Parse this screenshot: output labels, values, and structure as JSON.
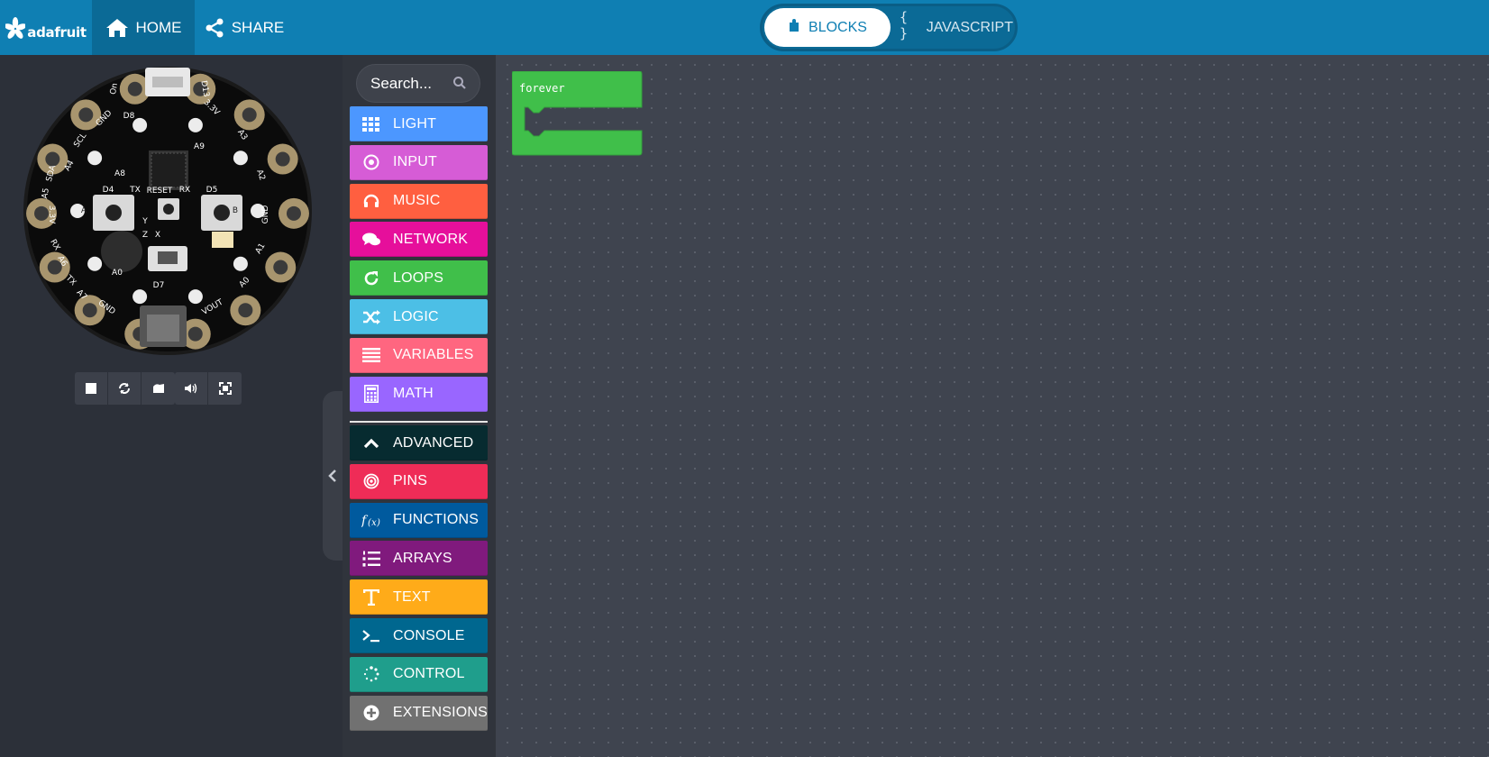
{
  "brand": {
    "name": "adafruit"
  },
  "nav": {
    "home_label": "HOME",
    "share_label": "SHARE"
  },
  "editor_toggle": {
    "blocks_label": "BLOCKS",
    "javascript_label": "JAVASCRIPT",
    "active": "BLOCKS"
  },
  "simulator": {
    "board_labels": [
      "On",
      "D13",
      "D8",
      "GND",
      "SCL",
      "A4",
      "3.3V",
      "A3",
      "A9",
      "A8",
      "SDA",
      "A5",
      "A2",
      "D4",
      "TX",
      "RESET",
      "RX",
      "D5",
      "3.3V",
      "GND",
      "RX",
      "A6",
      "A1",
      "Y",
      "Z",
      "X",
      "A0",
      "D7",
      "TX",
      "A7",
      "A0",
      "GND",
      "VOUT",
      "A",
      "B"
    ],
    "controls": [
      "stop-icon",
      "restart-icon",
      "slow-motion-icon",
      "sound-icon",
      "fullscreen-icon"
    ]
  },
  "toolbox": {
    "search_placeholder": "Search...",
    "categories": [
      {
        "label": "LIGHT",
        "color": "#4c97ff",
        "icon": "grid-icon"
      },
      {
        "label": "INPUT",
        "color": "#d65cd6",
        "icon": "target-icon"
      },
      {
        "label": "MUSIC",
        "color": "#ff5f40",
        "icon": "headphones-icon"
      },
      {
        "label": "NETWORK",
        "color": "#e60f9b",
        "icon": "chat-icon"
      },
      {
        "label": "LOOPS",
        "color": "#40bf4a",
        "icon": "refresh-icon"
      },
      {
        "label": "LOGIC",
        "color": "#4cbfe6",
        "icon": "shuffle-icon"
      },
      {
        "label": "VARIABLES",
        "color": "#ff6680",
        "icon": "list-lines-icon"
      },
      {
        "label": "MATH",
        "color": "#9966ff",
        "icon": "calculator-icon"
      }
    ],
    "advanced": [
      {
        "label": "ADVANCED",
        "color": "#072b30",
        "icon": "chevron-up-icon"
      },
      {
        "label": "PINS",
        "color": "#ef2c57",
        "icon": "pin-circle-icon"
      },
      {
        "label": "FUNCTIONS",
        "color": "#005a9e",
        "icon": "function-icon"
      },
      {
        "label": "ARRAYS",
        "color": "#801a7d",
        "icon": "numbered-list-icon"
      },
      {
        "label": "TEXT",
        "color": "#ffab19",
        "icon": "text-icon"
      },
      {
        "label": "CONSOLE",
        "color": "#00678f",
        "icon": "terminal-icon"
      },
      {
        "label": "CONTROL",
        "color": "#1f9e8c",
        "icon": "dotted-circle-icon"
      },
      {
        "label": "EXTENSIONS",
        "color": "#717171",
        "icon": "plus-circle-icon"
      }
    ]
  },
  "workspace": {
    "blocks": [
      {
        "label": "forever",
        "color": "#40bf4a"
      }
    ]
  }
}
